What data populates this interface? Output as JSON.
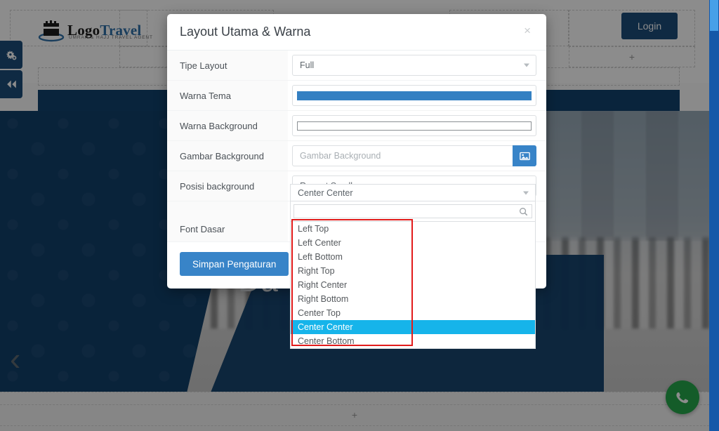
{
  "site": {
    "logo": {
      "primary_text": "Logo",
      "secondary_text": "Travel",
      "subtitle": "UMRAH & HAJJ TRAVEL AGENT"
    },
    "login_button": "Login",
    "hero_title": "Da                   ik",
    "placeholder_symbol": "+",
    "admin_buttons": [
      {
        "name": "settings-gears",
        "glyph": "⚙"
      },
      {
        "name": "collapse-left",
        "glyph": "«"
      }
    ],
    "carousel_prev": "‹",
    "whatsapp_label": "WhatsApp"
  },
  "modal": {
    "title": "Layout Utama & Warna",
    "close_label": "×",
    "save_button": "Simpan Pengaturan",
    "rows": [
      {
        "label": "Tipe Layout",
        "type": "select",
        "value": "Full"
      },
      {
        "label": "Warna Tema",
        "type": "color",
        "value": "#3480c2"
      },
      {
        "label": "Warna Background",
        "type": "color",
        "value": "#ffffff"
      },
      {
        "label": "Gambar Background",
        "type": "file",
        "value": "",
        "placeholder": "Gambar Background",
        "button_icon": "image-icon"
      },
      {
        "label": "Posisi background",
        "type": "select",
        "value": "Repeat Scroll"
      },
      {
        "label": "Font Dasar",
        "type": "select",
        "value": ""
      }
    ]
  },
  "dropdown": {
    "display_value": "Center Center",
    "search_value": "",
    "search_placeholder": "",
    "search_icon": "search-icon",
    "options": [
      "Left Top",
      "Left Center",
      "Left Bottom",
      "Right Top",
      "Right Center",
      "Right Bottom",
      "Center Top",
      "Center Center",
      "Center Bottom"
    ],
    "selected_index": 7
  },
  "annotation": {
    "color": "#e21b1b"
  },
  "colors": {
    "accent_blue": "#3884c8",
    "navy": "#12406b",
    "highlight_cyan": "#16b4ea",
    "whatsapp_green": "#25a84b",
    "scrollbar": "#1558a8"
  }
}
